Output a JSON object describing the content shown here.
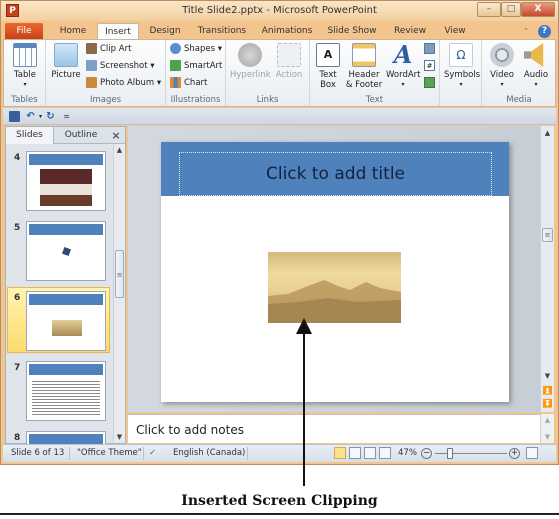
{
  "window": {
    "title": "Title Slide2.pptx - Microsoft PowerPoint",
    "app_icon": "P",
    "controls": {
      "minimize": "–",
      "maximize": "□",
      "close": "X"
    }
  },
  "tabs": [
    {
      "label": "File"
    },
    {
      "label": "Home"
    },
    {
      "label": "Insert",
      "active": true
    },
    {
      "label": "Design"
    },
    {
      "label": "Transitions"
    },
    {
      "label": "Animations"
    },
    {
      "label": "Slide Show"
    },
    {
      "label": "Review"
    },
    {
      "label": "View"
    }
  ],
  "ribbon": {
    "groups": {
      "tables": {
        "label": "Tables",
        "table": "Table"
      },
      "images": {
        "label": "Images",
        "picture": "Picture",
        "clip_art": "Clip Art",
        "screenshot": "Screenshot ▾",
        "photo_album": "Photo Album ▾"
      },
      "illustrations": {
        "label": "Illustrations",
        "shapes": "Shapes ▾",
        "smartart": "SmartArt",
        "chart": "Chart"
      },
      "links": {
        "label": "Links",
        "hyperlink": "Hyperlink",
        "action": "Action"
      },
      "text": {
        "label": "Text",
        "text_box_1": "Text",
        "text_box_2": "Box",
        "header_1": "Header",
        "header_2": "& Footer",
        "wordart": "WordArt"
      },
      "symbols": {
        "label": "",
        "symbols": "Symbols"
      },
      "media": {
        "label": "Media",
        "video": "Video",
        "audio": "Audio"
      }
    }
  },
  "panel": {
    "tabs": {
      "slides": "Slides",
      "outline": "Outline",
      "close": "×"
    },
    "thumbnails": [
      {
        "number": "4"
      },
      {
        "number": "5"
      },
      {
        "number": "6",
        "selected": true
      },
      {
        "number": "7"
      },
      {
        "number": "8"
      }
    ]
  },
  "slide": {
    "title_placeholder": "Click to add title"
  },
  "notes": {
    "placeholder": "Click to add notes"
  },
  "status": {
    "slide_info": "Slide 6 of 13",
    "theme": "\"Office Theme\"",
    "language": "English (Canada)",
    "zoom": "47%",
    "zoom_level_fraction": 0.47
  },
  "annotation": {
    "caption": "Inserted Screen Clipping"
  }
}
